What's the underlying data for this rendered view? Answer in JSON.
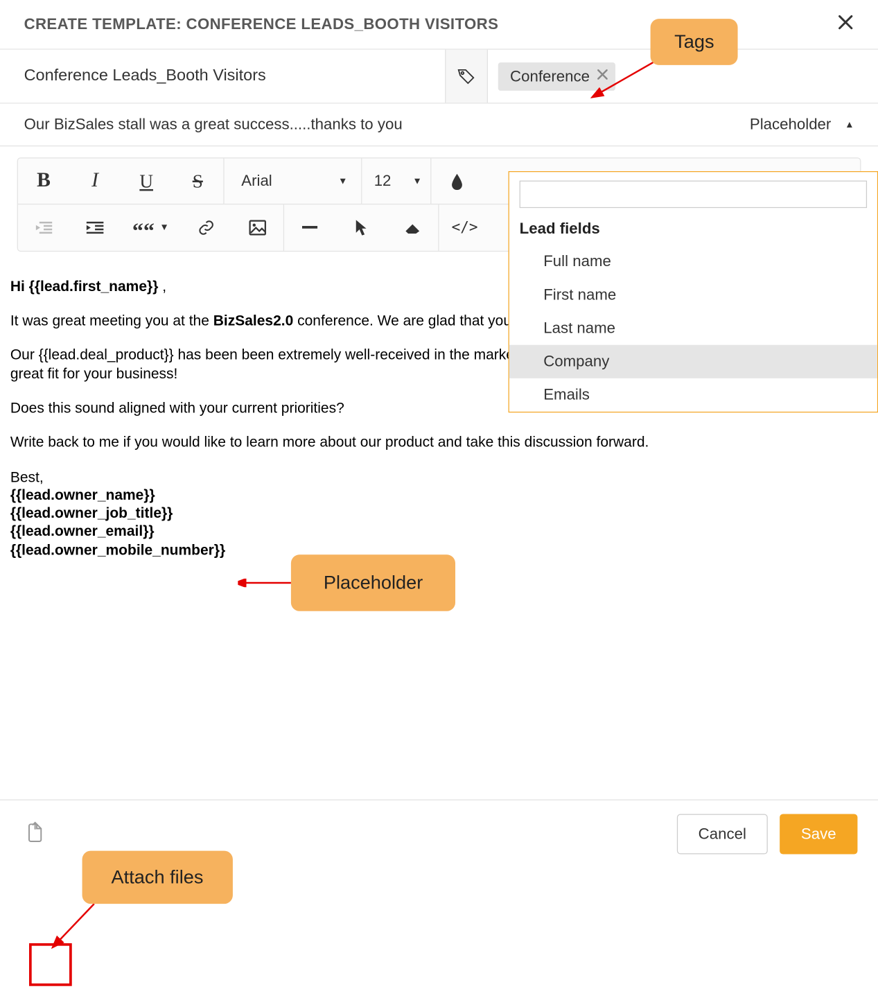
{
  "header": {
    "title": "CREATE TEMPLATE: CONFERENCE LEADS_BOOTH VISITORS"
  },
  "template": {
    "name": "Conference Leads_Booth Visitors",
    "subject": "Our BizSales stall was a great success.....thanks to you"
  },
  "tags": {
    "chip": "Conference"
  },
  "toolbar": {
    "font": "Arial",
    "size": "12"
  },
  "placeholder": {
    "label": "Placeholder",
    "heading": "Lead fields",
    "items": [
      "Full name",
      "First name",
      "Last name",
      "Company",
      "Emails"
    ],
    "hovered_index": 3
  },
  "body": {
    "greeting_prefix": "Hi ",
    "greeting_token": "{{lead.first_name}}",
    "greeting_suffix": " ,",
    "p1_a": "It was great meeting you at the ",
    "p1_bold": "BizSales2.0",
    "p1_b": " conference. We are glad that you expressed interest in our product.",
    "p2": "Our {{lead.deal_product}} has been been extremely well-received in the market, and given your requirements, I feel that it'd be a great fit for your business!",
    "p3": "Does this sound aligned with your current priorities?",
    "p4": "Write back to me if you would like to learn more about our product and take this discussion forward.",
    "sig_best": "Best,",
    "sig1": "{{lead.owner_name}}",
    "sig2": "{{lead.owner_job_title}}",
    "sig3": "{{lead.owner_email}}",
    "sig4": "{{lead.owner_mobile_number}}"
  },
  "callouts": {
    "tags": "Tags",
    "placeholder": "Placeholder",
    "attach": "Attach files"
  },
  "footer": {
    "cancel": "Cancel",
    "save": "Save"
  }
}
